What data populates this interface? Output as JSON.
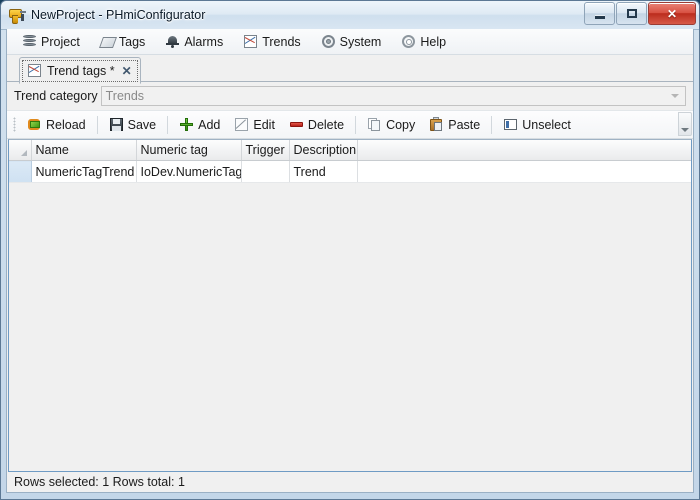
{
  "window": {
    "title": "NewProject - PHmiConfigurator",
    "icon": "drill-icon",
    "controls": {
      "minimize": "minimize-button",
      "maximize": "maximize-button",
      "close": "close-button",
      "close_glyph": "✕"
    }
  },
  "menubar": {
    "items": [
      {
        "label": "Project",
        "icon": "database-icon"
      },
      {
        "label": "Tags",
        "icon": "tag-icon"
      },
      {
        "label": "Alarms",
        "icon": "bell-icon"
      },
      {
        "label": "Trends",
        "icon": "chart-icon"
      },
      {
        "label": "System",
        "icon": "gear-icon"
      },
      {
        "label": "Help",
        "icon": "lifebuoy-icon"
      }
    ]
  },
  "tabs": [
    {
      "label": "Trend tags *",
      "icon": "chart-icon",
      "close_glyph": "✕",
      "active": true
    }
  ],
  "category": {
    "label": "Trend category",
    "value": "Trends",
    "placeholder": "Trends"
  },
  "toolbar": {
    "buttons": [
      {
        "label": "Reload",
        "icon": "reload-icon"
      },
      {
        "label": "Save",
        "icon": "save-icon"
      },
      {
        "label": "Add",
        "icon": "add-icon"
      },
      {
        "label": "Edit",
        "icon": "edit-icon"
      },
      {
        "label": "Delete",
        "icon": "delete-icon"
      },
      {
        "label": "Copy",
        "icon": "copy-icon"
      },
      {
        "label": "Paste",
        "icon": "paste-icon"
      },
      {
        "label": "Unselect",
        "icon": "unselect-icon"
      }
    ],
    "overflow": "toolbar-overflow-button"
  },
  "grid": {
    "columns": [
      "Name",
      "Numeric tag",
      "Trigger",
      "Description"
    ],
    "rows": [
      {
        "selected": true,
        "cells": [
          "NumericTagTrend",
          "IoDev.NumericTag",
          "",
          "Trend"
        ]
      }
    ]
  },
  "statusbar": {
    "text": "Rows selected: 1  Rows total: 1"
  },
  "colors": {
    "accent": "#6f9bc4",
    "selection": "#cfe1f2",
    "close_button": "#bb2c1d"
  }
}
